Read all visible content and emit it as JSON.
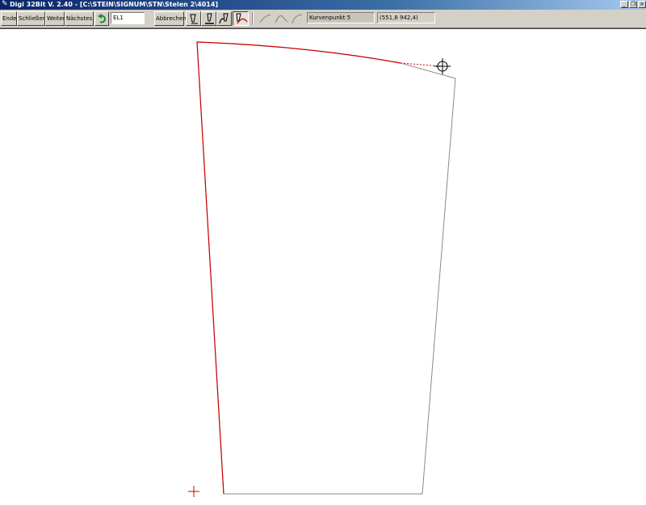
{
  "window": {
    "title": "Digi 32Bit  V. 2.40 - [C:\\STEIN\\SIGNUM\\STN\\Stelen 2\\4014]",
    "app_icon": "pen-icon"
  },
  "toolbar": {
    "end_label": "Ende",
    "close_label": "Schließen",
    "next_label": "Weiter",
    "nearest_label": "Nächstes",
    "undo_icon": "undo-arrow-icon",
    "element_field": "EL1",
    "cancel_label": "Abbrechen",
    "tool_icons": [
      "point-pen-icon",
      "line-pen-icon",
      "arc-pen-icon",
      "curve-pen-icon"
    ],
    "curve_icons": [
      "curve-flat-icon",
      "curve-peak-icon",
      "curve-rise-icon"
    ],
    "status_text": "Kurvenpunkt 5",
    "coordinates": "(551,8 942,4)"
  },
  "colors": {
    "titlebar": "#0a246a",
    "toolbar": "#d4d0c8",
    "traced_line": "#cc0000",
    "outline": "#808080",
    "canvas": "#ffffff"
  }
}
